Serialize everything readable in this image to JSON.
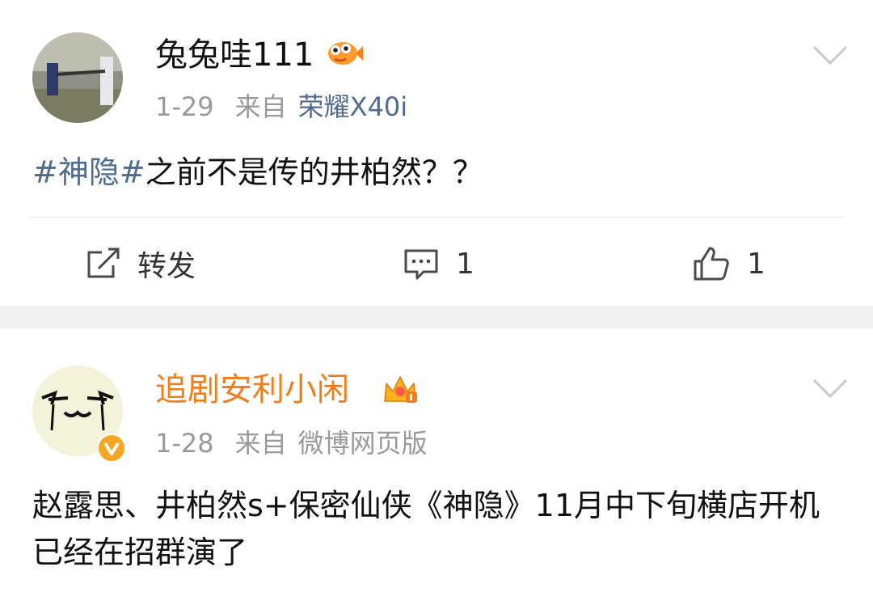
{
  "posts": [
    {
      "username": "兔兔哇111",
      "time": "1-29",
      "from_label": "来自",
      "source": "荣耀X40i",
      "content_hashtag": "#神隐#",
      "content_text": "之前不是传的井柏然？？",
      "actions": {
        "forward_label": "转发",
        "comment_count": "1",
        "like_count": "1"
      }
    },
    {
      "username": "追剧安利小闲",
      "time": "1-28",
      "from_label": "来自",
      "source": "微博网页版",
      "content_text": "赵露思、井柏然s+保密仙侠《神隐》11月中下旬横店开机 已经在招群演了"
    }
  ],
  "colors": {
    "username_default": "#111111",
    "username_vip": "#f07e1b",
    "link_blue": "#506b8c",
    "meta_gray": "#9a9a9a",
    "divider": "#f1f1f1"
  },
  "icons": {
    "badge1": "fish-icon",
    "badge2": "crown-icon",
    "verified": "verified-v-icon",
    "menu": "chevron-down-icon",
    "forward": "share-icon",
    "comment": "comment-icon",
    "like": "thumbs-up-icon"
  }
}
